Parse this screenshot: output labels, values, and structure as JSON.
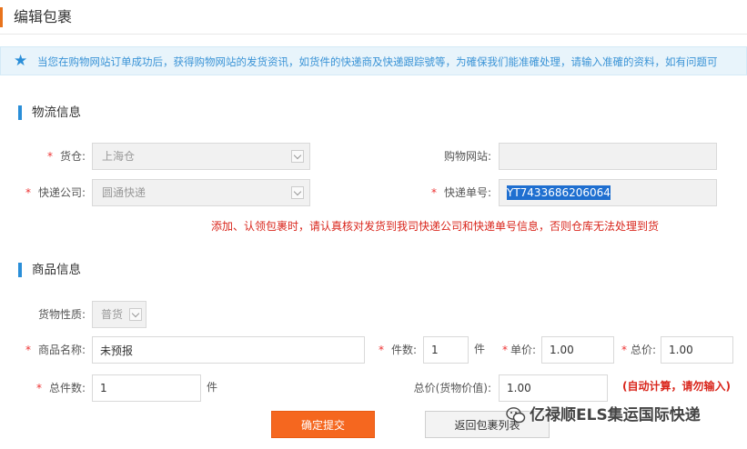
{
  "page": {
    "title": "编辑包裹"
  },
  "notice": {
    "text": "当您在购物网站订单成功后，获得购物网站的发货资讯，如货件的快递商及快递跟踪號等，为確保我们能准確处理，请输入准確的资料，如有问题可"
  },
  "logistics": {
    "section_title": "物流信息",
    "warehouse": {
      "label": "货仓:",
      "value": "上海仓"
    },
    "shop_site": {
      "label": "购物网站:",
      "value": ""
    },
    "courier": {
      "label": "快递公司:",
      "value": "圆通快递"
    },
    "tracking": {
      "label": "快递单号:",
      "value": "YT7433686206064"
    },
    "warning": "添加、认领包裹时，请认真核对发货到我司快递公司和快递单号信息，否则仓库无法处理到货"
  },
  "goods": {
    "section_title": "商品信息",
    "nature": {
      "label": "货物性质:",
      "value": "普货"
    },
    "name": {
      "label": "商品名称:",
      "value": "未预报"
    },
    "pieces": {
      "label": "件数:",
      "value": "1",
      "unit": "件"
    },
    "unit_price": {
      "label": "单价:",
      "value": "1.00"
    },
    "total_price": {
      "label": "总价:",
      "value": "1.00"
    },
    "total_pieces": {
      "label": "总件数:",
      "value": "1",
      "unit": "件"
    },
    "declared_total": {
      "label": "总价(货物价值):",
      "value": "1.00"
    },
    "auto_note": "(自动计算，请勿输入)"
  },
  "actions": {
    "submit": "确定提交",
    "back": "返回包裹列表"
  },
  "watermark": {
    "text": "亿禄顺ELS集运国际快递"
  },
  "colors": {
    "accent": "#f5671f",
    "section_bar": "#2a8ed8",
    "warning": "#d9261c",
    "required": "#e33333"
  }
}
